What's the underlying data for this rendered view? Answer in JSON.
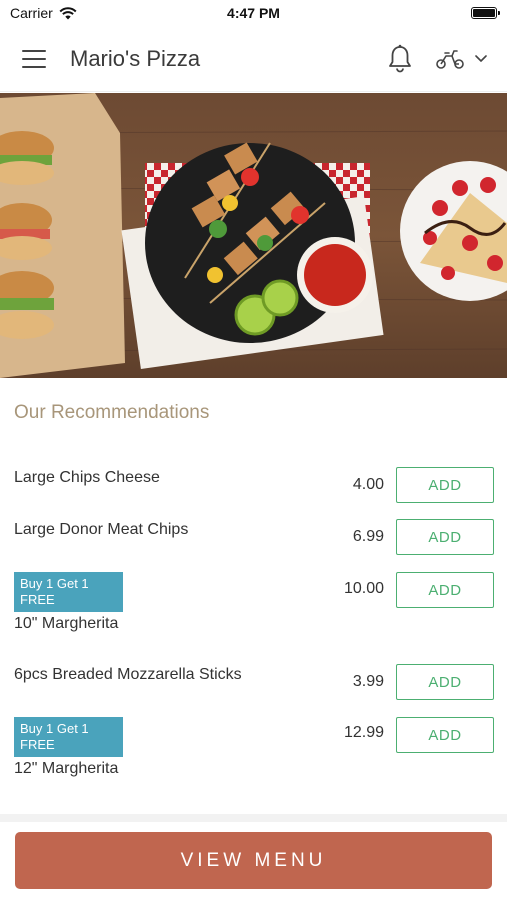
{
  "status_bar": {
    "carrier": "Carrier",
    "time": "4:47 PM"
  },
  "header": {
    "title": "Mario's Pizza"
  },
  "section": {
    "title": "Our Recommendations"
  },
  "items": [
    {
      "name": "Large Chips Cheese",
      "price": "4.00",
      "add_label": "ADD"
    },
    {
      "name": "Large Donor Meat Chips",
      "price": "6.99",
      "add_label": "ADD"
    },
    {
      "badge_line1": "Buy 1 Get 1",
      "badge_line2": "FREE",
      "name": "10\" Margherita",
      "price": "10.00",
      "add_label": "ADD"
    },
    {
      "name": "6pcs Breaded Mozzarella Sticks",
      "price": "3.99",
      "add_label": "ADD"
    },
    {
      "badge_line1": "Buy 1 Get 1",
      "badge_line2": "FREE",
      "name": "12\" Margherita",
      "price": "12.99",
      "add_label": "ADD"
    }
  ],
  "footer": {
    "view_menu_label": "VIEW MENU"
  },
  "colors": {
    "accent": "#c0664f",
    "add_green": "#4caf71",
    "badge_blue": "#4aa3bc",
    "section_title": "#a8967a"
  },
  "icons": {
    "menu": "hamburger-icon",
    "notifications": "bell-icon",
    "delivery": "scooter-icon",
    "dropdown": "chevron-down-icon"
  }
}
